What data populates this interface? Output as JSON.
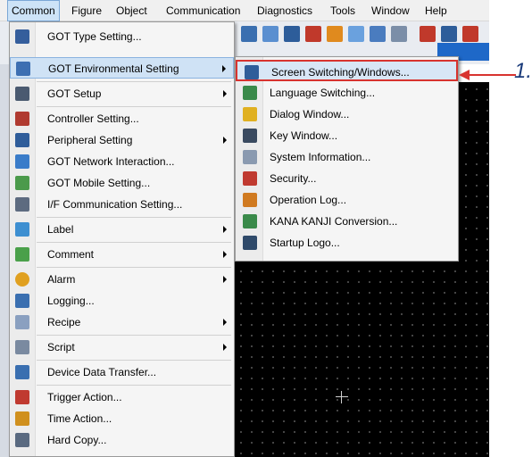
{
  "menubar": {
    "items": [
      "Common",
      "Figure",
      "Object",
      "Communication",
      "Diagnostics",
      "Tools",
      "Window",
      "Help"
    ]
  },
  "menu": {
    "items": [
      {
        "label": "GOT Type Setting...",
        "icon": "got-type-icon",
        "submenu": false
      },
      {
        "label": "GOT Environmental Setting",
        "icon": "environment-icon",
        "submenu": true,
        "highlighted": true
      },
      {
        "label": "GOT Setup",
        "icon": "setup-icon",
        "submenu": true
      },
      {
        "label": "Controller Setting...",
        "icon": "controller-icon",
        "submenu": false
      },
      {
        "label": "Peripheral Setting",
        "icon": "peripheral-icon",
        "submenu": true
      },
      {
        "label": "GOT Network Interaction...",
        "icon": "network-icon",
        "submenu": false
      },
      {
        "label": "GOT Mobile Setting...",
        "icon": "mobile-icon",
        "submenu": false
      },
      {
        "label": "I/F Communication Setting...",
        "icon": "interface-icon",
        "submenu": false
      },
      {
        "label": "Label",
        "icon": "label-icon",
        "submenu": true
      },
      {
        "label": "Comment",
        "icon": "comment-icon",
        "submenu": true
      },
      {
        "label": "Alarm",
        "icon": "alarm-icon",
        "submenu": true
      },
      {
        "label": "Logging...",
        "icon": "logging-icon",
        "submenu": false
      },
      {
        "label": "Recipe",
        "icon": "recipe-icon",
        "submenu": true
      },
      {
        "label": "Script",
        "icon": "script-icon",
        "submenu": true
      },
      {
        "label": "Device Data Transfer...",
        "icon": "device-transfer-icon",
        "submenu": false
      },
      {
        "label": "Trigger Action...",
        "icon": "trigger-icon",
        "submenu": false
      },
      {
        "label": "Time Action...",
        "icon": "time-icon",
        "submenu": false
      },
      {
        "label": "Hard Copy...",
        "icon": "hardcopy-icon",
        "submenu": false
      }
    ]
  },
  "submenu": {
    "items": [
      {
        "label": "Screen Switching/Windows...",
        "icon": "screen-switching-icon",
        "highlighted": true
      },
      {
        "label": "Language Switching...",
        "icon": "language-icon"
      },
      {
        "label": "Dialog Window...",
        "icon": "dialog-icon"
      },
      {
        "label": "Key Window...",
        "icon": "key-window-icon"
      },
      {
        "label": "System Information...",
        "icon": "system-info-icon"
      },
      {
        "label": "Security...",
        "icon": "security-icon"
      },
      {
        "label": "Operation Log...",
        "icon": "operation-log-icon"
      },
      {
        "label": "KANA KANJI Conversion...",
        "icon": "kana-kanji-icon"
      },
      {
        "label": "Startup Logo...",
        "icon": "startup-logo-icon"
      }
    ]
  },
  "callout": {
    "label": "1."
  },
  "colors": {
    "highlight_border": "#d8332f",
    "callout": "#1a3b7a",
    "menu_highlight": "#cfe2f5"
  }
}
